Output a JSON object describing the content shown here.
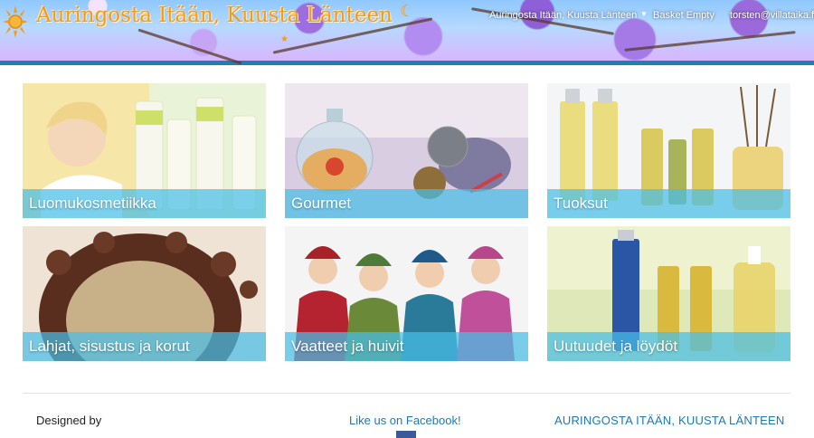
{
  "header": {
    "site_title": "Auringosta Itään, Kuusta Länteen",
    "nav": {
      "site_link": "Auringosta Itään, Kuusta Länteen",
      "basket": "Basket Empty",
      "user": "torsten@villataika.fi"
    },
    "brand_color": "#f39a1a",
    "bar_color": "#1e7fb0"
  },
  "categories": [
    {
      "label": "Luomukosmetiikka"
    },
    {
      "label": "Gourmet"
    },
    {
      "label": "Tuoksut"
    },
    {
      "label": "Lahjat, sisustus ja korut"
    },
    {
      "label": "Vaatteet ja huivit"
    },
    {
      "label": "Uutuudet ja löydöt"
    }
  ],
  "footer": {
    "designed_by": "Designed by",
    "facebook": "Like us on Facebook!",
    "brand": "AURINGOSTA ITÄÄN, KUUSTA LÄNTEEN"
  },
  "icons": [
    "sun-icon",
    "moon-icon",
    "star-icon",
    "chevron-down-icon",
    "facebook-icon"
  ]
}
